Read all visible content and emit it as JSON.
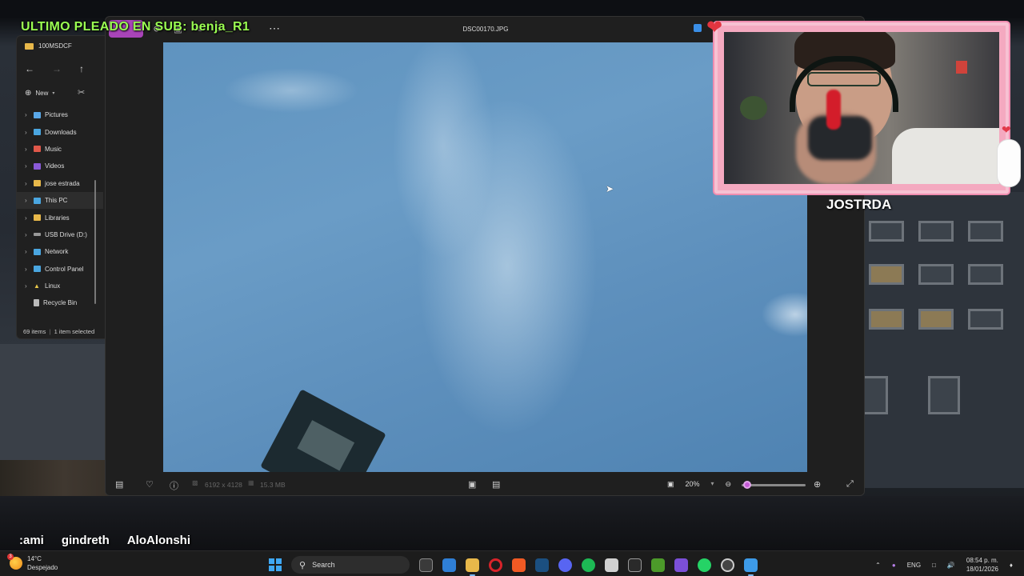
{
  "overlay": {
    "sub_banner": "ULTIMO PLEADO EN SUB: benja_R1",
    "chat_names": [
      ":ami",
      "gindreth",
      "AloAlonshi"
    ],
    "cam_name": "JOSTRDA"
  },
  "explorer": {
    "folder": "100MSDCF",
    "new_label": "New",
    "tree": [
      {
        "label": "Pictures",
        "icon_color": "#5aa8e8"
      },
      {
        "label": "Downloads",
        "icon_color": "#4aa6e0"
      },
      {
        "label": "Music",
        "icon_color": "#e0584a"
      },
      {
        "label": "Videos",
        "icon_color": "#8a5ad8"
      },
      {
        "label": "jose estrada",
        "icon_color": "#e8b84a"
      },
      {
        "label": "This PC",
        "icon_color": "#4aa6e0"
      },
      {
        "label": "Libraries",
        "icon_color": "#e8b84a"
      },
      {
        "label": "USB Drive (D:)",
        "icon_color": "#999999"
      },
      {
        "label": "Network",
        "icon_color": "#4aa6e0"
      },
      {
        "label": "Control Panel",
        "icon_color": "#4aa6e0"
      },
      {
        "label": "Linux",
        "icon_color": "#e8c84a"
      },
      {
        "label": "Recycle Bin",
        "icon_color": "#bbbbbb"
      }
    ],
    "status_items": "69 items",
    "status_selected": "1 item selected"
  },
  "viewer": {
    "filename": "DSC00170.JPG",
    "dimensions": "6192 x 4128",
    "file_size": "15.3 MB",
    "zoom": "20%",
    "zoom_level_fraction": 0.03
  },
  "taskbar": {
    "temperature": "14°C",
    "weather": "Despejado",
    "weather_badge": "3",
    "search_placeholder": "Search",
    "language": "ENG",
    "time": "08:54 p. m.",
    "date": "18/01/2026"
  },
  "colors": {
    "accent": "#a844b8",
    "banner": "#9bff52",
    "cam_border": "#f7c1d2"
  }
}
